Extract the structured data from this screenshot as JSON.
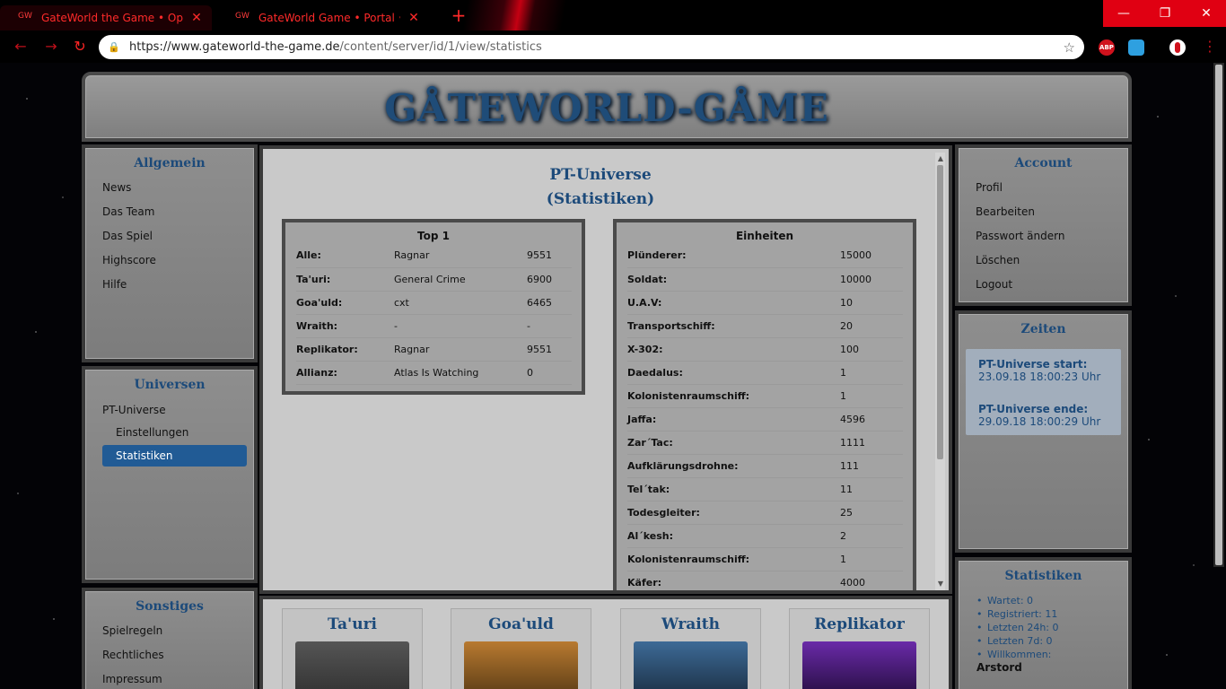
{
  "browser": {
    "tabs": [
      {
        "favicon": "GW",
        "title": "GateWorld the Game • Open Bet"
      },
      {
        "favicon": "GW",
        "title": "GateWorld Game • Portal • Unive"
      }
    ],
    "close_glyph": "✕",
    "new_tab_glyph": "+",
    "url_host": "https://www.gateworld-the-game.de",
    "url_path": "/content/server/id/1/view/statistics",
    "extensions": [
      "ABP"
    ],
    "window_buttons": {
      "minimize": "—",
      "maximize": "❐",
      "close": "✕"
    },
    "nav_glyphs": {
      "back": "←",
      "forward": "→",
      "reload": "↻",
      "lock": "🔒",
      "star": "☆",
      "menu": "⋮"
    }
  },
  "header": {
    "logo": "GÅTEWORLD-GÅME"
  },
  "left": {
    "allgemein": {
      "title": "Allgemein",
      "items": [
        "News",
        "Das Team",
        "Das Spiel",
        "Highscore",
        "Hilfe"
      ]
    },
    "universen": {
      "title": "Universen",
      "item": "PT-Universe",
      "sub1": "Einstellungen",
      "sub2": "Statistiken"
    },
    "sonstiges": {
      "title": "Sonstiges",
      "items": [
        "Spielregeln",
        "Rechtliches",
        "Impressum"
      ]
    }
  },
  "right": {
    "account": {
      "title": "Account",
      "items": [
        "Profil",
        "Bearbeiten",
        "Passwort ändern",
        "Löschen",
        "Logout"
      ]
    },
    "zeiten": {
      "title": "Zeiten",
      "start_label": "PT-Universe start:",
      "start_value": "23.09.18 18:00:23 Uhr",
      "end_label": "PT-Universe ende:",
      "end_value": "29.09.18 18:00:29 Uhr"
    },
    "stats": {
      "title": "Statistiken",
      "items": [
        "Wartet: 0",
        "Registriert: 11",
        "Letzten 24h: 0",
        "Letzten 7d: 0",
        "Willkommen:"
      ],
      "user": "Arstord"
    }
  },
  "main": {
    "title_line1": "PT-Universe",
    "title_line2": "(Statistiken)",
    "top1": {
      "title": "Top 1",
      "rows": [
        {
          "k": "Alle:",
          "n": "Ragnar",
          "v": "9551"
        },
        {
          "k": "Ta'uri:",
          "n": "General Crime",
          "v": "6900"
        },
        {
          "k": "Goa'uld:",
          "n": "cxt",
          "v": "6465"
        },
        {
          "k": "Wraith:",
          "n": "-",
          "v": "-"
        },
        {
          "k": "Replikator:",
          "n": "Ragnar",
          "v": "9551"
        },
        {
          "k": "Allianz:",
          "n": "Atlas Is Watching",
          "v": "0"
        }
      ]
    },
    "units": {
      "title": "Einheiten",
      "rows": [
        {
          "k": "Plünderer:",
          "v": "15000"
        },
        {
          "k": "Soldat:",
          "v": "10000"
        },
        {
          "k": "U.A.V:",
          "v": "10"
        },
        {
          "k": "Transportschiff:",
          "v": "20"
        },
        {
          "k": "X-302:",
          "v": "100"
        },
        {
          "k": "Daedalus:",
          "v": "1"
        },
        {
          "k": "Kolonistenraumschiff:",
          "v": "1"
        },
        {
          "k": "Jaffa:",
          "v": "4596"
        },
        {
          "k": "Zar´Tac:",
          "v": "1111"
        },
        {
          "k": "Aufklärungsdrohne:",
          "v": "111"
        },
        {
          "k": "Tel´tak:",
          "v": "11"
        },
        {
          "k": "Todesgleiter:",
          "v": "25"
        },
        {
          "k": "Al´kesh:",
          "v": "2"
        },
        {
          "k": "Kolonistenraumschiff:",
          "v": "1"
        },
        {
          "k": "Käfer:",
          "v": "4000"
        }
      ]
    }
  },
  "races": [
    "Ta'uri",
    "Goa'uld",
    "Wraith",
    "Replikator"
  ]
}
